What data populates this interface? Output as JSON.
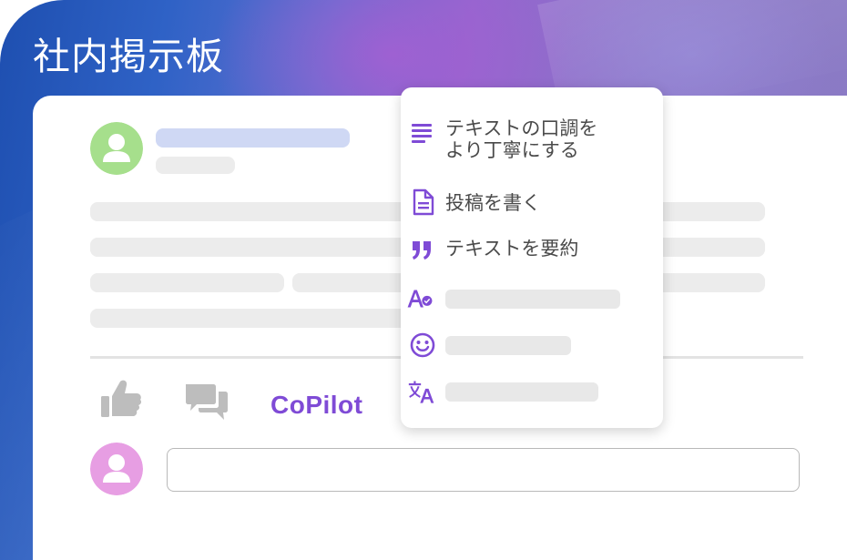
{
  "app": {
    "title": "社内掲示板"
  },
  "colors": {
    "accent": "#7f4bd6",
    "avatar_top": "#a6df8c",
    "avatar_bottom": "#e79ee3",
    "skeleton": "#ececec",
    "skeleton_name": "#cfd8f4"
  },
  "post": {
    "avatar_icon": "user-avatar-icon"
  },
  "actions": {
    "like_icon": "thumbs-up-icon",
    "comment_icon": "comments-icon",
    "copilot_label": "CoPilot"
  },
  "menu": {
    "items": [
      {
        "icon": "lines-icon",
        "label": "テキストの口調を\nより丁寧にする"
      },
      {
        "icon": "document-icon",
        "label": "投稿を書く"
      },
      {
        "icon": "quote-icon",
        "label": "テキストを要約"
      },
      {
        "icon": "spell-check-icon",
        "label": ""
      },
      {
        "icon": "smiley-icon",
        "label": ""
      },
      {
        "icon": "translate-icon",
        "label": ""
      }
    ]
  },
  "comment": {
    "placeholder": ""
  }
}
